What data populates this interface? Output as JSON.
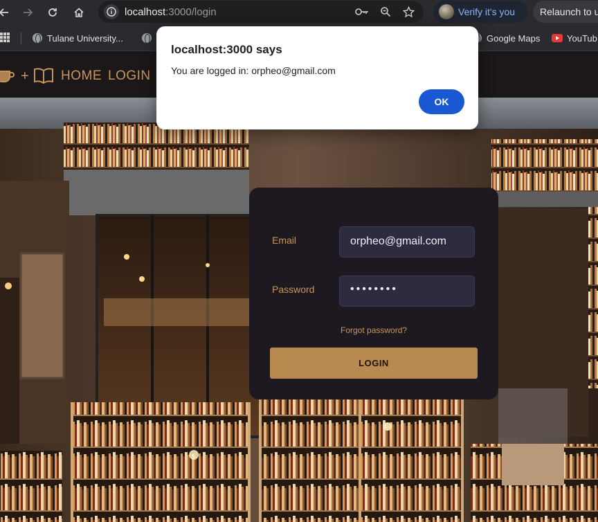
{
  "browser": {
    "url_host": "localhost",
    "url_path": ":3000/login",
    "verify_label": "Verify it's you",
    "relaunch_label": "Relaunch to u",
    "bookmarks": [
      {
        "label": "Tulane University...",
        "icon": "globe-icon"
      },
      {
        "label": "Google Maps",
        "icon": "globe-icon"
      },
      {
        "label": "YouTub",
        "icon": "youtube-icon"
      }
    ]
  },
  "nav": {
    "plus": "+",
    "home_label": "HOME",
    "login_label": "LOGIN"
  },
  "login_form": {
    "email_label": "Email",
    "email_value": "orpheo@gmail.com",
    "password_label": "Password",
    "password_value": "••••••••",
    "forgot_label": "Forgot password?",
    "submit_label": "LOGIN"
  },
  "alert": {
    "title": "localhost:3000 says",
    "message": "You are logged in: orpheo@gmail.com",
    "ok_label": "OK"
  },
  "colors": {
    "accent": "#c8955a",
    "button": "#b98a50",
    "dialog_ok": "#1a57d2",
    "card": "#1e1820"
  }
}
